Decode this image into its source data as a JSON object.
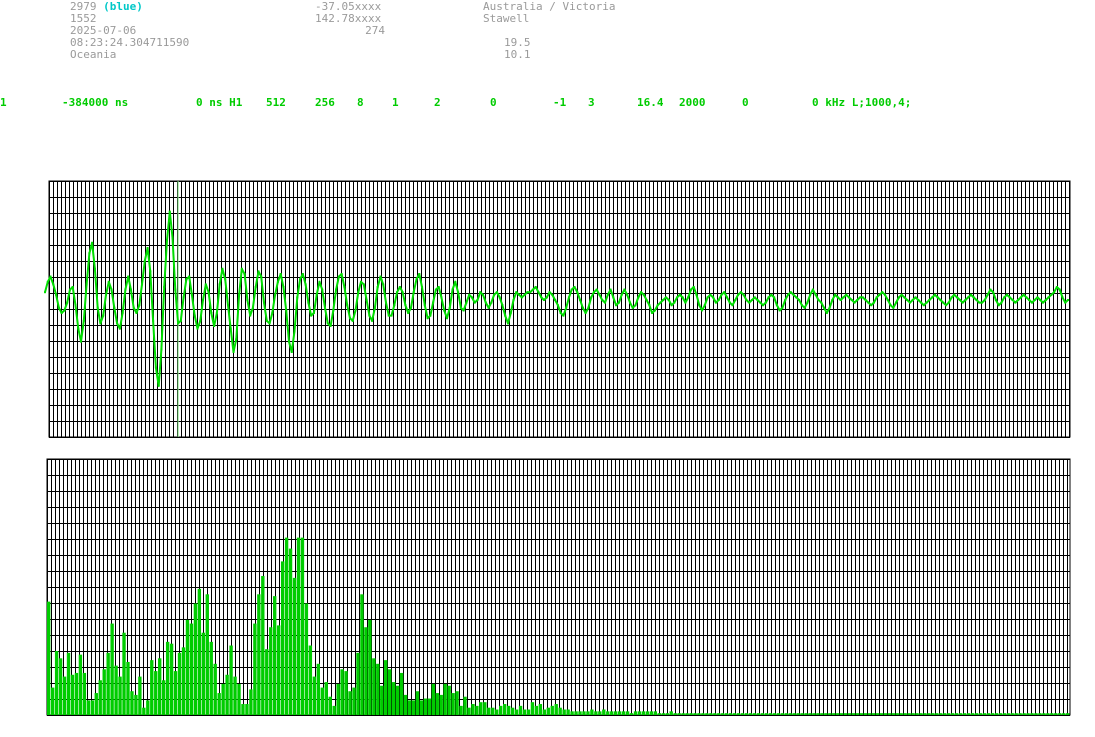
{
  "header": {
    "station_id": "2979",
    "station_color": "(blue)",
    "station_number": "1552",
    "date": "2025-07-06",
    "time": "08:23:24.304711590",
    "continent": "Oceania",
    "latitude": "-37.05xxxx",
    "longitude": "142.78xxxx",
    "altitude": "274",
    "region": "Australia / Victoria",
    "city": "Stawell",
    "value_1": "19.5",
    "value_2": "10.1"
  },
  "params": {
    "p1": "1",
    "p2": "-384000 ns",
    "p3": "0 ns H1",
    "p4": "512",
    "p5": "256",
    "p6": "8",
    "p7": "1",
    "p8": "2",
    "p9": "0",
    "p10": "-1",
    "p11": "3",
    "p12": "16.4",
    "p13": "2000",
    "p14": "0",
    "p15": "0 kHz L;1000,4;"
  },
  "colors": {
    "grid": "#000000",
    "trace": "#00dd00",
    "bars": "#00cc00",
    "marker": "#88ee88",
    "header_text": "#9a9a9a",
    "header_accent": "#00c8c8"
  },
  "chart_data": [
    {
      "type": "line",
      "description_series": "waveform",
      "y": [
        0.3,
        0.7,
        0.9,
        0.6,
        0.2,
        -0.3,
        -0.5,
        -0.4,
        -0.1,
        0.4,
        0.5,
        -0.2,
        -1.1,
        -1.6,
        -0.8,
        0.6,
        1.8,
        2.2,
        1.2,
        -0.3,
        -0.9,
        -0.6,
        0.2,
        0.7,
        0.4,
        -0.3,
        -0.9,
        -1.1,
        -0.5,
        0.4,
        0.9,
        0.4,
        -0.3,
        -0.5,
        -0.2,
        0.6,
        1.5,
        2.0,
        1.1,
        -0.8,
        -2.6,
        -3.3,
        -1.9,
        0.5,
        2.3,
        3.4,
        2.4,
        0.4,
        -0.9,
        -0.8,
        0.1,
        0.8,
        0.9,
        0.2,
        -0.6,
        -1.1,
        -0.8,
        0.0,
        0.6,
        0.3,
        -0.5,
        -1.0,
        -0.5,
        0.6,
        1.2,
        0.8,
        -0.2,
        -1.1,
        -2.0,
        -1.5,
        0.2,
        1.2,
        1.0,
        0.0,
        -0.6,
        -0.3,
        0.5,
        1.1,
        0.9,
        -0.1,
        -0.8,
        -0.9,
        -0.5,
        0.2,
        0.7,
        1.0,
        0.5,
        -0.4,
        -1.6,
        -2.0,
        -1.2,
        0.1,
        0.8,
        1.0,
        0.6,
        -0.1,
        -0.6,
        -0.5,
        0.2,
        0.7,
        0.4,
        -0.3,
        -0.9,
        -1.0,
        -0.4,
        0.4,
        0.9,
        1.0,
        0.5,
        -0.2,
        -0.7,
        -0.8,
        -0.4,
        0.3,
        0.7,
        0.6,
        0.0,
        -0.6,
        -0.8,
        -0.3,
        0.5,
        0.9,
        0.6,
        -0.1,
        -0.6,
        -0.6,
        -0.2,
        0.3,
        0.5,
        0.3,
        -0.2,
        -0.5,
        -0.3,
        0.3,
        0.8,
        1.0,
        0.5,
        -0.2,
        -0.7,
        -0.6,
        -0.1,
        0.4,
        0.5,
        0.1,
        -0.4,
        -0.7,
        -0.3,
        0.4,
        0.7,
        0.3,
        -0.3,
        -0.4,
        -0.1,
        0.2,
        0.1,
        -0.1,
        0.0,
        0.3,
        0.2,
        -0.1,
        -0.3,
        -0.1,
        0.2,
        0.3,
        0.1,
        -0.2,
        -0.6,
        -0.9,
        -0.5,
        0.0,
        0.3,
        0.2,
        0.1,
        0.2,
        0.3,
        0.3,
        0.4,
        0.5,
        0.3,
        0.1,
        0.0,
        0.1,
        0.3,
        0.2,
        0.0,
        -0.2,
        -0.5,
        -0.6,
        -0.3,
        0.1,
        0.4,
        0.5,
        0.3,
        0.0,
        -0.3,
        -0.5,
        -0.3,
        0.1,
        0.3,
        0.4,
        0.2,
        0.0,
        -0.1,
        0.2,
        0.4,
        0.1,
        -0.2,
        -0.1,
        0.2,
        0.4,
        0.2,
        -0.1,
        -0.3,
        -0.2,
        0.1,
        0.3,
        0.2,
        0.0,
        -0.2,
        -0.5,
        -0.4,
        -0.2,
        -0.1,
        0.0,
        0.1,
        0.0,
        -0.2,
        -0.1,
        0.1,
        0.2,
        0.1,
        -0.1,
        0.1,
        0.4,
        0.5,
        0.2,
        -0.2,
        -0.4,
        -0.2,
        0.1,
        0.2,
        0.1,
        -0.1,
        0.0,
        0.2,
        0.3,
        0.1,
        -0.1,
        -0.2,
        0.0,
        0.2,
        0.3,
        0.2,
        0.0,
        -0.1,
        0.0,
        0.1,
        0.0,
        -0.1,
        -0.2,
        -0.1,
        0.1,
        0.2,
        0.1,
        -0.2,
        -0.4,
        -0.3,
        0.0,
        0.2,
        0.3,
        0.2,
        0.1,
        0.0,
        -0.2,
        -0.3,
        -0.1,
        0.2,
        0.4,
        0.2,
        0.0,
        -0.1,
        -0.3,
        -0.5,
        -0.3,
        0.0,
        0.2,
        0.1,
        0.0,
        0.1,
        0.2,
        0.1,
        0.0,
        -0.1,
        0.0,
        0.1,
        0.1,
        0.0,
        -0.1,
        -0.2,
        -0.1,
        0.1,
        0.2,
        0.3,
        0.2,
        0.0,
        -0.2,
        -0.3,
        -0.1,
        0.1,
        0.2,
        0.1,
        0.0,
        -0.1,
        0.0,
        0.1,
        0.0,
        -0.1,
        -0.2,
        -0.1,
        0.0,
        0.1,
        0.2,
        0.1,
        0.0,
        -0.1,
        -0.2,
        -0.1,
        0.1,
        0.2,
        0.1,
        0.0,
        -0.1,
        0.0,
        0.1,
        0.2,
        0.1,
        0.0,
        -0.1,
        -0.1,
        0.0,
        0.2,
        0.4,
        0.3,
        0.0,
        -0.2,
        -0.1,
        0.1,
        0.2,
        0.1,
        0.0,
        -0.1,
        0.0,
        0.1,
        0.2,
        0.1,
        0.0,
        -0.1,
        0.0,
        0.1,
        0.0,
        -0.1,
        0.0,
        0.1,
        0.2,
        0.3,
        0.5,
        0.4,
        0.1,
        -0.1,
        0.0
      ],
      "ylim": [
        -5,
        5
      ],
      "marker_index": 48
    },
    {
      "type": "bar",
      "values": [
        6.2,
        1.5,
        3.5,
        3.1,
        2.1,
        3.4,
        2.2,
        2.3,
        3.3,
        2.3,
        0.8,
        0.8,
        1.2,
        1.9,
        2.5,
        3.4,
        5.0,
        2.7,
        2.1,
        4.5,
        2.9,
        1.3,
        1.1,
        2.1,
        0.4,
        0.8,
        3.0,
        2.4,
        3.1,
        1.9,
        4.0,
        3.9,
        2.4,
        3.4,
        3.7,
        5.2,
        5.0,
        6.1,
        6.9,
        4.5,
        6.6,
        4.0,
        2.8,
        1.2,
        1.7,
        2.2,
        3.8,
        2.1,
        1.7,
        0.6,
        0.6,
        1.4,
        5.0,
        6.6,
        7.6,
        3.6,
        4.8,
        6.5,
        4.9,
        8.4,
        9.7,
        9.1,
        7.5,
        9.7,
        9.7,
        6.1,
        3.8,
        2.1,
        2.8,
        1.5,
        1.8,
        1.0,
        0.5,
        1.7,
        2.5,
        2.4,
        1.3,
        1.5,
        3.4,
        6.6,
        4.8,
        5.2,
        3.1,
        2.8,
        1.6,
        3.0,
        2.5,
        1.8,
        1.6,
        2.3,
        1.1,
        0.8,
        0.8,
        1.3,
        0.8,
        0.9,
        0.9,
        1.7,
        1.2,
        1.1,
        1.7,
        1.6,
        1.2,
        1.3,
        0.5,
        1.0,
        0.4,
        0.6,
        0.5,
        0.7,
        0.7,
        0.4,
        0.4,
        0.3,
        0.5,
        0.6,
        0.5,
        0.4,
        0.3,
        0.5,
        0.3,
        0.3,
        0.7,
        0.5,
        0.6,
        0.3,
        0.4,
        0.5,
        0.6,
        0.4,
        0.3,
        0.3,
        0.2,
        0.2,
        0.2,
        0.2,
        0.2,
        0.3,
        0.2,
        0.2,
        0.3,
        0.2,
        0.2,
        0.2,
        0.2,
        0.2,
        0.2,
        0.1,
        0.2,
        0.2,
        0.2,
        0.2,
        0.2,
        0.2,
        0.1,
        0.1,
        0.1,
        0.2,
        0.1,
        0.1,
        0.1,
        0.1,
        0.1,
        0.1,
        0.1,
        0.1,
        0.1,
        0.1,
        0.1,
        0.1,
        0.1,
        0.1,
        0.1,
        0.1,
        0.1,
        0.1,
        0.1,
        0.1,
        0.1,
        0.1,
        0.1,
        0.1,
        0.1,
        0.1,
        0.1,
        0.1,
        0.1,
        0.1,
        0.1,
        0.1,
        0.1,
        0.1,
        0.1,
        0.1,
        0.1,
        0.1,
        0.1,
        0.1,
        0.1,
        0.1,
        0.1,
        0.1,
        0.1,
        0.1,
        0.1,
        0.1,
        0.1,
        0.1,
        0.1,
        0.1,
        0.1,
        0.1,
        0.1,
        0.1,
        0.1,
        0.1,
        0.1,
        0.1,
        0.1,
        0.1,
        0.1,
        0.1,
        0.1,
        0.1,
        0.1,
        0.1,
        0.1,
        0.1,
        0.1,
        0.1,
        0.1,
        0.1,
        0.1,
        0.1,
        0.1,
        0.1,
        0.1,
        0.1,
        0.1,
        0.1,
        0.1,
        0.1,
        0.1,
        0.1,
        0.1,
        0.1,
        0.1,
        0.1,
        0.1,
        0.1,
        0.1,
        0.1,
        0.1,
        0.1,
        0.1,
        0.1,
        0.1,
        0.1
      ],
      "ylim": [
        0,
        14
      ]
    }
  ]
}
